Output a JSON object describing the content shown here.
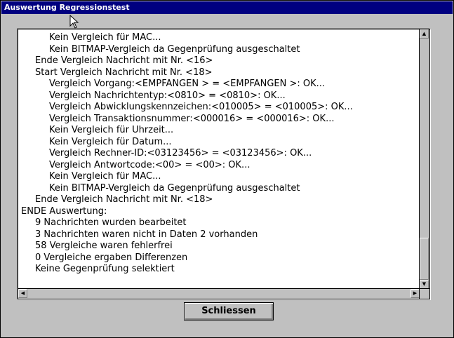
{
  "window": {
    "title": "Auswertung Regressionstest",
    "colors": {
      "titlebar": "#000080",
      "face": "#c0c0c0",
      "list_background": "#ffffff"
    }
  },
  "log": {
    "lines": [
      {
        "indent": 2,
        "text": "Kein Vergleich für MAC..."
      },
      {
        "indent": 2,
        "text": "Kein BITMAP-Vergleich da Gegenprüfung ausgeschaltet"
      },
      {
        "indent": 1,
        "text": "Ende Vergleich Nachricht mit Nr. <16>"
      },
      {
        "indent": 1,
        "text": "Start Vergleich Nachricht mit Nr. <18>"
      },
      {
        "indent": 2,
        "text": "Vergleich Vorgang:<EMPFANGEN > = <EMPFANGEN >: OK..."
      },
      {
        "indent": 2,
        "text": "Vergleich Nachrichtentyp:<0810> = <0810>: OK..."
      },
      {
        "indent": 2,
        "text": "Vergleich Abwicklungskennzeichen:<010005> = <010005>: OK..."
      },
      {
        "indent": 2,
        "text": "Vergleich Transaktionsnummer:<000016> = <000016>: OK..."
      },
      {
        "indent": 2,
        "text": "Kein Vergleich für Uhrzeit..."
      },
      {
        "indent": 2,
        "text": "Kein Vergleich für Datum..."
      },
      {
        "indent": 2,
        "text": "Vergleich Rechner-ID:<03123456> = <03123456>: OK..."
      },
      {
        "indent": 2,
        "text": "Vergleich Antwortcode:<00> = <00>: OK..."
      },
      {
        "indent": 2,
        "text": "Kein Vergleich für MAC..."
      },
      {
        "indent": 2,
        "text": "Kein BITMAP-Vergleich da Gegenprüfung ausgeschaltet"
      },
      {
        "indent": 1,
        "text": "Ende Vergleich Nachricht mit Nr. <18>"
      },
      {
        "indent": 0,
        "text": "ENDE Auswertung:"
      },
      {
        "indent": 1,
        "text": "9 Nachrichten wurden bearbeitet"
      },
      {
        "indent": 1,
        "text": "3 Nachrichten waren nicht in Daten 2 vorhanden"
      },
      {
        "indent": 1,
        "text": "58 Vergleiche waren fehlerfrei"
      },
      {
        "indent": 1,
        "text": "0 Vergleiche ergaben Differenzen"
      },
      {
        "indent": 1,
        "text": "Keine Gegenprüfung selektiert"
      }
    ]
  },
  "scrollbar": {
    "vertical_position": 1.0
  },
  "buttons": {
    "close_label": "Schliessen"
  },
  "icons": {
    "cursor": "mouse-pointer-icon",
    "scroll_up": "arrow-up-icon",
    "scroll_down": "arrow-down-icon",
    "scroll_left": "arrow-left-icon",
    "scroll_right": "arrow-right-icon"
  }
}
